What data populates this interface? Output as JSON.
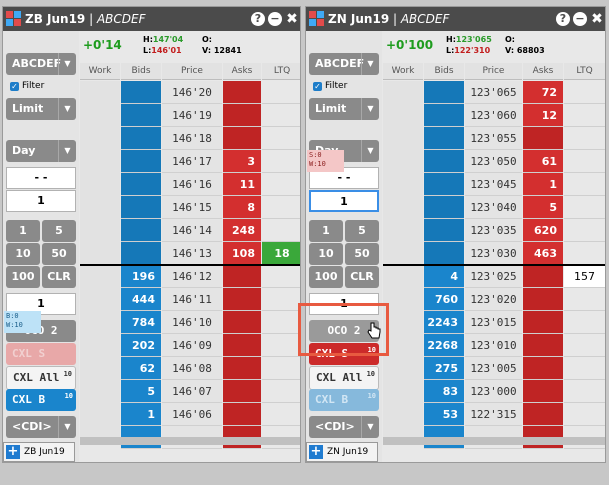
{
  "colors": {
    "bid": "#1a85cc",
    "ask": "#cc2a2a",
    "ltq_green": "#3aa83a",
    "title_bar": "#4b4b4b",
    "highlight": "#e85a40"
  },
  "columns": [
    "Work",
    "Bids",
    "Price",
    "Asks",
    "LTQ"
  ],
  "left": {
    "title_sym": "ZB Jun19",
    "title_sep": " | ",
    "title_acct": "ABCDEF",
    "title_buttons": {
      "help": "?",
      "minimize": "−",
      "close": "✖"
    },
    "position": "+0'14",
    "hi_label": "H:",
    "hi_val": "147'04",
    "lo_label": "L:",
    "lo_val": "146'01",
    "o_label": "O:",
    "o_val": "",
    "v_label": "V:",
    "v_val": "12841",
    "account": "ABCDEF",
    "filter": "Filter",
    "order_type": "Limit",
    "tif": "Day",
    "input_a": "- -",
    "qty": "1",
    "qty_buttons": [
      "1",
      "5",
      "10",
      "50",
      "100",
      "CLR"
    ],
    "qty2": "1",
    "oco": "OCO 2",
    "cxl_s": "CXL S",
    "cxl_all": "CXL All",
    "cxl_all_count": "10",
    "cxl_b": "CXL B",
    "cxl_b_count": "10",
    "cdi": "<CDI>",
    "prices": [
      "146'20",
      "146'19",
      "146'18",
      "146'17",
      "146'16",
      "146'15",
      "146'14",
      "146'13",
      "146'12",
      "146'11",
      "146'10",
      "146'09",
      "146'08",
      "146'07",
      "146'06",
      ""
    ],
    "asks": [
      "",
      "",
      "",
      "3",
      "11",
      "8",
      "248",
      "108",
      "",
      "",
      "",
      "",
      "",
      "",
      "",
      ""
    ],
    "bids": [
      "",
      "",
      "",
      "",
      "",
      "",
      "",
      "",
      "196",
      "444",
      "784",
      "202",
      "62",
      "5",
      "1",
      ""
    ],
    "ltq": [
      "",
      "",
      "",
      "",
      "",
      "",
      "",
      "18",
      "",
      "",
      "",
      "",
      "",
      "",
      "",
      ""
    ],
    "work_note": {
      "b": "B:0",
      "w": "W:10"
    },
    "tab_label": "ZB Jun19",
    "plus": "+"
  },
  "right": {
    "title_sym": "ZN Jun19",
    "title_sep": " | ",
    "title_acct": "ABCDEF",
    "title_buttons": {
      "help": "?",
      "minimize": "−",
      "close": "✖"
    },
    "position": "+0'100",
    "hi_label": "H:",
    "hi_val": "123'065",
    "lo_label": "L:",
    "lo_val": "122'310",
    "o_label": "O:",
    "o_val": "",
    "v_label": "V:",
    "v_val": "68803",
    "account": "ABCDEF",
    "filter": "Filter",
    "order_type": "Limit",
    "tif": "Day",
    "input_a": "- -",
    "qty": "1",
    "qty_buttons": [
      "1",
      "5",
      "10",
      "50",
      "100",
      "CLR"
    ],
    "qty2": "1",
    "oco": "OCO 2",
    "cxl_s": "CXL S",
    "cxl_s_count": "10",
    "cxl_all": "CXL All",
    "cxl_all_count": "10",
    "cxl_b": "CXL B",
    "cxl_b_count": "10",
    "cdi": "<CDI>",
    "prices": [
      "123'065",
      "123'060",
      "123'055",
      "123'050",
      "123'045",
      "123'040",
      "123'035",
      "123'030",
      "123'025",
      "123'020",
      "123'015",
      "123'010",
      "123'005",
      "123'000",
      "122'315",
      ""
    ],
    "asks": [
      "72",
      "12",
      "",
      "61",
      "1",
      "5",
      "620",
      "463",
      "",
      "",
      "",
      "",
      "",
      "",
      "",
      ""
    ],
    "bids": [
      "",
      "",
      "",
      "",
      "",
      "",
      "",
      "",
      "4",
      "760",
      "2243",
      "2268",
      "275",
      "83",
      "53",
      ""
    ],
    "ltq": [
      "",
      "",
      "",
      "",
      "",
      "",
      "",
      "",
      "157",
      "",
      "",
      "",
      "",
      "",
      "",
      ""
    ],
    "work_note": {
      "s": "S:0",
      "w": "W:10"
    },
    "tab_label": "ZN Jun19",
    "plus": "+"
  }
}
